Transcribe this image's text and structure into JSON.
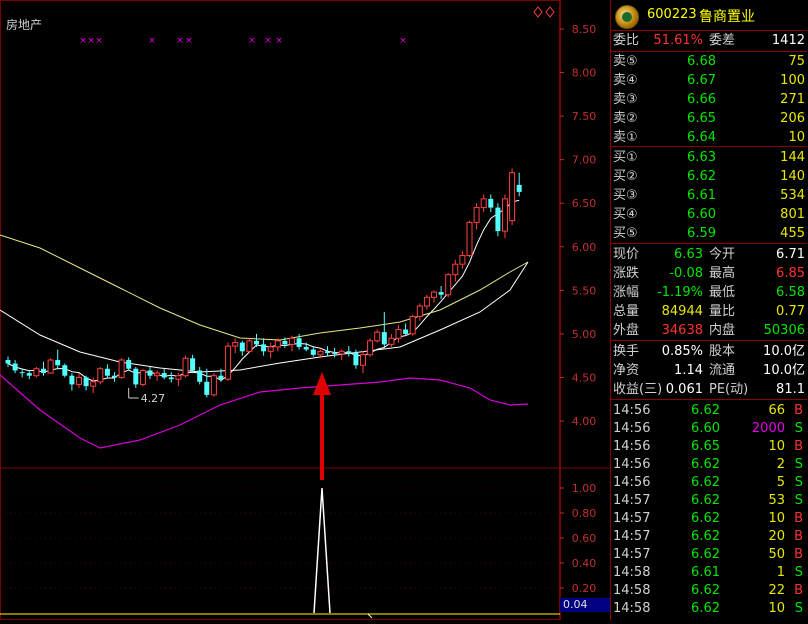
{
  "chart": {
    "sector_label": "房地产",
    "low_label": "4.27",
    "indicator_value": "0.04",
    "price_ticks": [
      "8.50",
      "8.00",
      "7.50",
      "7.00",
      "6.50",
      "6.00",
      "5.50",
      "5.00",
      "4.50",
      "4.00"
    ],
    "indicator_ticks": [
      "1.00",
      "0.80",
      "0.60",
      "0.40",
      "0.20"
    ],
    "colors": {
      "up": "#ff4040",
      "down": "#54ffff",
      "ma_short": "#ffffff",
      "ma_long": "#e8e888",
      "ma_purple": "#d800d8",
      "grid": "#7a0000",
      "arrow": "#e00000"
    }
  },
  "stock": {
    "code": "600223",
    "name": "鲁商置业"
  },
  "order_book": {
    "weibi": {
      "label": "委比",
      "value": "51.61%",
      "diff_label": "委差",
      "diff": "1412"
    },
    "asks": [
      {
        "label": "卖⑤",
        "price": "6.68",
        "vol": "75"
      },
      {
        "label": "卖④",
        "price": "6.67",
        "vol": "100"
      },
      {
        "label": "卖③",
        "price": "6.66",
        "vol": "271"
      },
      {
        "label": "卖②",
        "price": "6.65",
        "vol": "206"
      },
      {
        "label": "卖①",
        "price": "6.64",
        "vol": "10"
      }
    ],
    "bids": [
      {
        "label": "买①",
        "price": "6.63",
        "vol": "144"
      },
      {
        "label": "买②",
        "price": "6.62",
        "vol": "140"
      },
      {
        "label": "买③",
        "price": "6.61",
        "vol": "534"
      },
      {
        "label": "买④",
        "price": "6.60",
        "vol": "801"
      },
      {
        "label": "买⑤",
        "price": "6.59",
        "vol": "455"
      }
    ]
  },
  "quote": [
    {
      "l1": "现价",
      "v1": "6.63",
      "c1": "green",
      "l2": "今开",
      "v2": "6.71",
      "c2": "white"
    },
    {
      "l1": "涨跌",
      "v1": "-0.08",
      "c1": "green",
      "l2": "最高",
      "v2": "6.85",
      "c2": "red"
    },
    {
      "l1": "涨幅",
      "v1": "-1.19%",
      "c1": "green",
      "l2": "最低",
      "v2": "6.58",
      "c2": "green"
    },
    {
      "l1": "总量",
      "v1": "84944",
      "c1": "yellow",
      "l2": "量比",
      "v2": "0.77",
      "c2": "yellow"
    },
    {
      "l1": "外盘",
      "v1": "34638",
      "c1": "red",
      "l2": "内盘",
      "v2": "50306",
      "c2": "green"
    }
  ],
  "finance": [
    {
      "l1": "换手",
      "v1": "0.85%",
      "l2": "股本",
      "v2": "10.0亿"
    },
    {
      "l1": "净资",
      "v1": "1.14",
      "l2": "流通",
      "v2": "10.0亿"
    },
    {
      "l1": "收益(三)",
      "v1": "0.061",
      "l2": "PE(动)",
      "v2": "81.1"
    }
  ],
  "ticks": [
    {
      "time": "14:56",
      "price": "6.62",
      "vol": "66",
      "side": "B"
    },
    {
      "time": "14:56",
      "price": "6.60",
      "vol": "2000",
      "side": "S"
    },
    {
      "time": "14:56",
      "price": "6.65",
      "vol": "10",
      "side": "B"
    },
    {
      "time": "14:56",
      "price": "6.62",
      "vol": "2",
      "side": "S"
    },
    {
      "time": "14:56",
      "price": "6.62",
      "vol": "5",
      "side": "S"
    },
    {
      "time": "14:57",
      "price": "6.62",
      "vol": "53",
      "side": "S"
    },
    {
      "time": "14:57",
      "price": "6.62",
      "vol": "10",
      "side": "B"
    },
    {
      "time": "14:57",
      "price": "6.62",
      "vol": "20",
      "side": "B"
    },
    {
      "time": "14:57",
      "price": "6.62",
      "vol": "50",
      "side": "B"
    },
    {
      "time": "14:58",
      "price": "6.61",
      "vol": "1",
      "side": "S"
    },
    {
      "time": "14:58",
      "price": "6.62",
      "vol": "22",
      "side": "B"
    },
    {
      "time": "14:58",
      "price": "6.62",
      "vol": "10",
      "side": "S"
    }
  ],
  "candles": [
    [
      4.7,
      4.74,
      4.62,
      4.66
    ],
    [
      4.66,
      4.7,
      4.55,
      4.58
    ],
    [
      4.56,
      4.6,
      4.5,
      4.55
    ],
    [
      4.55,
      4.58,
      4.48,
      4.52
    ],
    [
      4.52,
      4.62,
      4.5,
      4.6
    ],
    [
      4.6,
      4.68,
      4.52,
      4.55
    ],
    [
      4.55,
      4.72,
      4.55,
      4.7
    ],
    [
      4.7,
      4.82,
      4.6,
      4.64
    ],
    [
      4.64,
      4.66,
      4.5,
      4.52
    ],
    [
      4.52,
      4.55,
      4.35,
      4.42
    ],
    [
      4.42,
      4.55,
      4.38,
      4.5
    ],
    [
      4.5,
      4.52,
      4.35,
      4.4
    ],
    [
      4.4,
      4.5,
      4.32,
      4.45
    ],
    [
      4.45,
      4.62,
      4.42,
      4.6
    ],
    [
      4.6,
      4.65,
      4.5,
      4.52
    ],
    [
      4.52,
      4.56,
      4.45,
      4.5
    ],
    [
      4.5,
      4.72,
      4.48,
      4.7
    ],
    [
      4.7,
      4.73,
      4.58,
      4.6
    ],
    [
      4.6,
      4.62,
      4.38,
      4.42
    ],
    [
      4.42,
      4.6,
      4.4,
      4.58
    ],
    [
      4.58,
      4.62,
      4.48,
      4.52
    ],
    [
      4.52,
      4.58,
      4.46,
      4.55
    ],
    [
      4.55,
      4.6,
      4.48,
      4.5
    ],
    [
      4.5,
      4.56,
      4.44,
      4.48
    ],
    [
      4.48,
      4.55,
      4.4,
      4.52
    ],
    [
      4.52,
      4.75,
      4.5,
      4.72
    ],
    [
      4.72,
      4.76,
      4.55,
      4.58
    ],
    [
      4.58,
      4.62,
      4.42,
      4.45
    ],
    [
      4.45,
      4.6,
      4.27,
      4.3
    ],
    [
      4.3,
      4.55,
      4.28,
      4.52
    ],
    [
      4.52,
      4.6,
      4.45,
      4.48
    ],
    [
      4.48,
      4.9,
      4.46,
      4.86
    ],
    [
      4.86,
      4.95,
      4.78,
      4.9
    ],
    [
      4.9,
      4.92,
      4.75,
      4.8
    ],
    [
      4.8,
      4.95,
      4.78,
      4.92
    ],
    [
      4.92,
      5.0,
      4.85,
      4.88
    ],
    [
      4.88,
      4.95,
      4.75,
      4.8
    ],
    [
      4.8,
      4.9,
      4.72,
      4.85
    ],
    [
      4.85,
      4.95,
      4.8,
      4.92
    ],
    [
      4.92,
      4.96,
      4.84,
      4.88
    ],
    [
      4.88,
      4.98,
      4.8,
      4.95
    ],
    [
      4.95,
      5.0,
      4.82,
      4.85
    ],
    [
      4.85,
      4.9,
      4.8,
      4.82
    ],
    [
      4.82,
      4.85,
      4.74,
      4.76
    ],
    [
      4.76,
      4.82,
      4.72,
      4.8
    ],
    [
      4.8,
      4.86,
      4.74,
      4.78
    ],
    [
      4.78,
      4.84,
      4.73,
      4.77
    ],
    [
      4.77,
      4.82,
      4.7,
      4.8
    ],
    [
      4.8,
      4.86,
      4.74,
      4.78
    ],
    [
      4.78,
      4.82,
      4.6,
      4.64
    ],
    [
      4.64,
      4.8,
      4.55,
      4.76
    ],
    [
      4.76,
      4.95,
      4.74,
      4.92
    ],
    [
      4.92,
      5.05,
      4.9,
      5.02
    ],
    [
      5.02,
      5.25,
      4.85,
      4.88
    ],
    [
      4.88,
      5.0,
      4.85,
      4.95
    ],
    [
      4.95,
      5.1,
      4.9,
      5.05
    ],
    [
      5.05,
      5.12,
      4.98,
      5.0
    ],
    [
      5.0,
      5.22,
      4.98,
      5.2
    ],
    [
      5.2,
      5.35,
      5.15,
      5.32
    ],
    [
      5.32,
      5.45,
      5.28,
      5.42
    ],
    [
      5.42,
      5.5,
      5.36,
      5.48
    ],
    [
      5.48,
      5.55,
      5.4,
      5.45
    ],
    [
      5.45,
      5.7,
      5.42,
      5.68
    ],
    [
      5.68,
      5.85,
      5.6,
      5.8
    ],
    [
      5.8,
      5.95,
      5.75,
      5.9
    ],
    [
      5.9,
      6.3,
      5.88,
      6.28
    ],
    [
      6.28,
      6.5,
      6.2,
      6.45
    ],
    [
      6.45,
      6.6,
      6.4,
      6.55
    ],
    [
      6.55,
      6.6,
      6.4,
      6.45
    ],
    [
      6.45,
      6.5,
      6.12,
      6.18
    ],
    [
      6.18,
      6.6,
      6.1,
      6.55
    ],
    [
      6.3,
      6.9,
      6.25,
      6.85
    ],
    [
      6.71,
      6.85,
      6.58,
      6.63
    ]
  ]
}
